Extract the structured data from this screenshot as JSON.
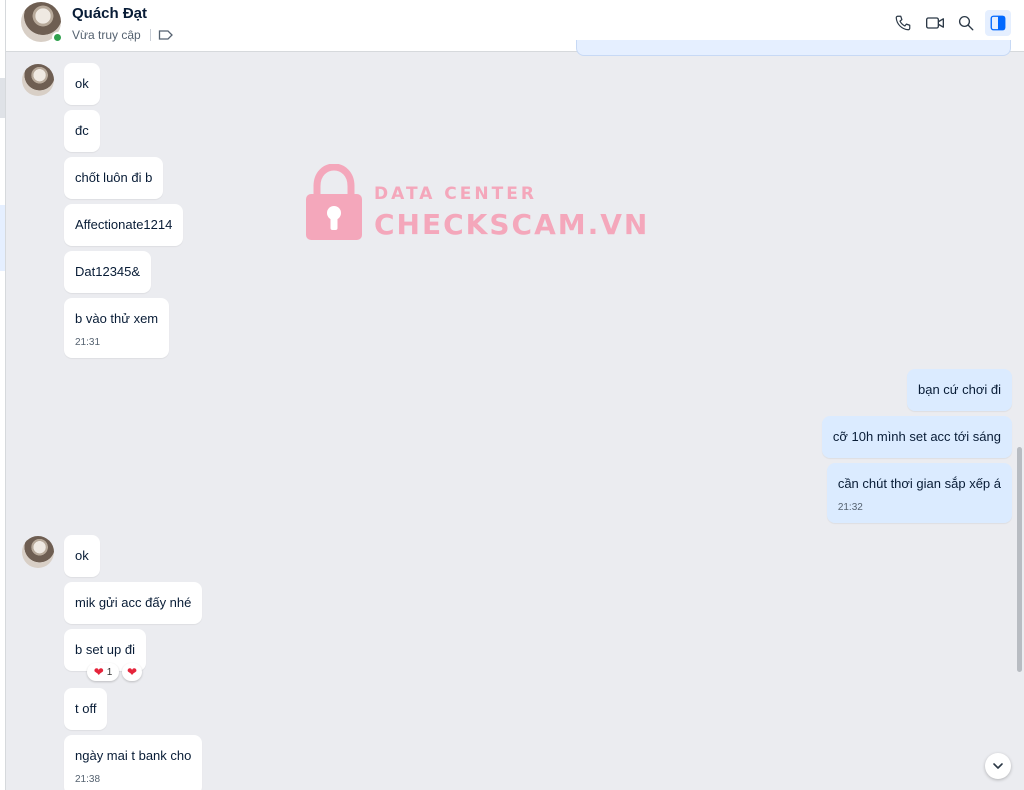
{
  "contact": {
    "name": "Quách Đạt",
    "status": "Vừa truy cập"
  },
  "header_icons": [
    "phone-icon",
    "video-icon",
    "search-icon",
    "panel-toggle-icon"
  ],
  "watermark": {
    "line1": "DATA CENTER",
    "line2": "CHECKSCAM.VN"
  },
  "messages": {
    "group1": [
      {
        "text": "ok"
      },
      {
        "text": "đc"
      },
      {
        "text": "chốt luôn đi b"
      },
      {
        "text": "Affectionate1214"
      },
      {
        "text": "Dat12345&"
      },
      {
        "text": "b vào thử xem",
        "time": "21:31"
      }
    ],
    "group2": [
      {
        "text": "bạn cứ chơi đi"
      },
      {
        "text": "cỡ 10h mình set acc tới sáng"
      },
      {
        "text": "cần chút thơi gian sắp xếp á",
        "time": "21:32"
      }
    ],
    "group3": [
      {
        "text": "ok"
      },
      {
        "text": "mik gửi acc đấy nhé"
      },
      {
        "text": "b set up đi",
        "reaction_count": "1"
      },
      {
        "text": "t off"
      },
      {
        "text": "ngày mai t bank cho",
        "time": "21:38"
      }
    ]
  },
  "colors": {
    "incoming_bubble": "#ffffff",
    "outgoing_bubble": "#dbebff",
    "background": "#ebecf0",
    "online": "#30a14e",
    "heart": "#e5243b",
    "watermark": "#f4a7bb"
  }
}
